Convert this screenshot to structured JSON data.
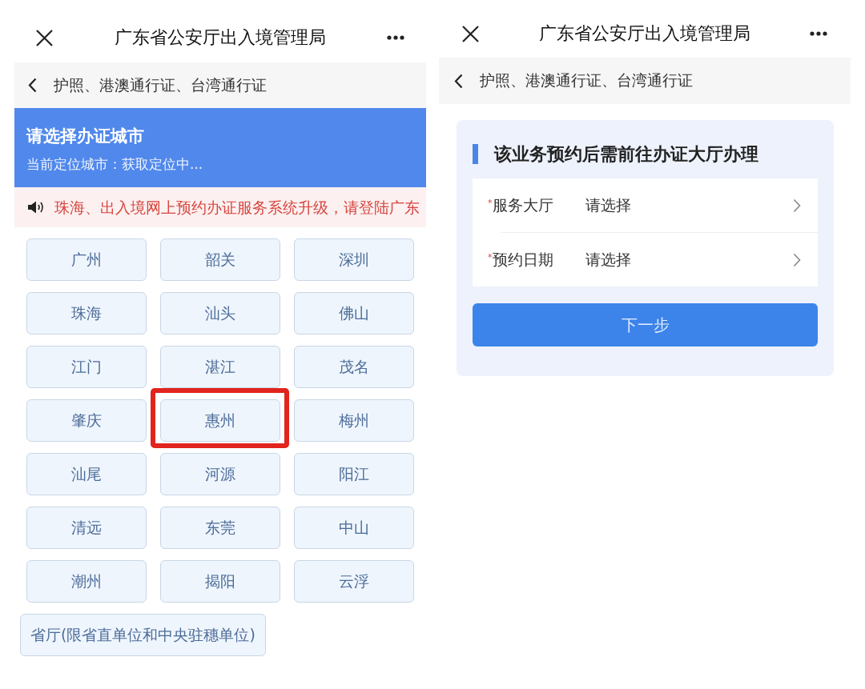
{
  "city_screen": {
    "title_bar": {
      "title": "广东省公安厅出入境管理局"
    },
    "breadcrumb": {
      "label": "护照、港澳通行证、台湾通行证"
    },
    "city_header": {
      "title": "请选择办证城市",
      "subtitle": "当前定位城市：获取定位中..."
    },
    "notice": {
      "text": "珠海、出入境网上预约办证服务系统升级，请登陆广东"
    },
    "cities": [
      {
        "name": "广州",
        "highlighted": false
      },
      {
        "name": "韶关",
        "highlighted": false
      },
      {
        "name": "深圳",
        "highlighted": false
      },
      {
        "name": "珠海",
        "highlighted": false
      },
      {
        "name": "汕头",
        "highlighted": false
      },
      {
        "name": "佛山",
        "highlighted": false
      },
      {
        "name": "江门",
        "highlighted": false
      },
      {
        "name": "湛江",
        "highlighted": false
      },
      {
        "name": "茂名",
        "highlighted": false
      },
      {
        "name": "肇庆",
        "highlighted": false
      },
      {
        "name": "惠州",
        "highlighted": true
      },
      {
        "name": "梅州",
        "highlighted": false
      },
      {
        "name": "汕尾",
        "highlighted": false
      },
      {
        "name": "河源",
        "highlighted": false
      },
      {
        "name": "阳江",
        "highlighted": false
      },
      {
        "name": "清远",
        "highlighted": false
      },
      {
        "name": "东莞",
        "highlighted": false
      },
      {
        "name": "中山",
        "highlighted": false
      },
      {
        "name": "潮州",
        "highlighted": false
      },
      {
        "name": "揭阳",
        "highlighted": false
      },
      {
        "name": "云浮",
        "highlighted": false
      }
    ],
    "province_office": {
      "label": "省厅(限省直单位和中央驻穗单位)"
    }
  },
  "appointment_screen": {
    "title_bar": {
      "title": "广东省公安厅出入境管理局"
    },
    "breadcrumb": {
      "label": "护照、港澳通行证、台湾通行证"
    },
    "card": {
      "heading": "该业务预约后需前往办证大厅办理",
      "fields": [
        {
          "label": "$^{*}$服务大厅",
          "placeholder": "请选择"
        },
        {
          "label": "$^{*}$预约日期",
          "placeholder": "请选择"
        }
      ],
      "next_button": {
        "label": "下一步"
      }
    }
  }
}
